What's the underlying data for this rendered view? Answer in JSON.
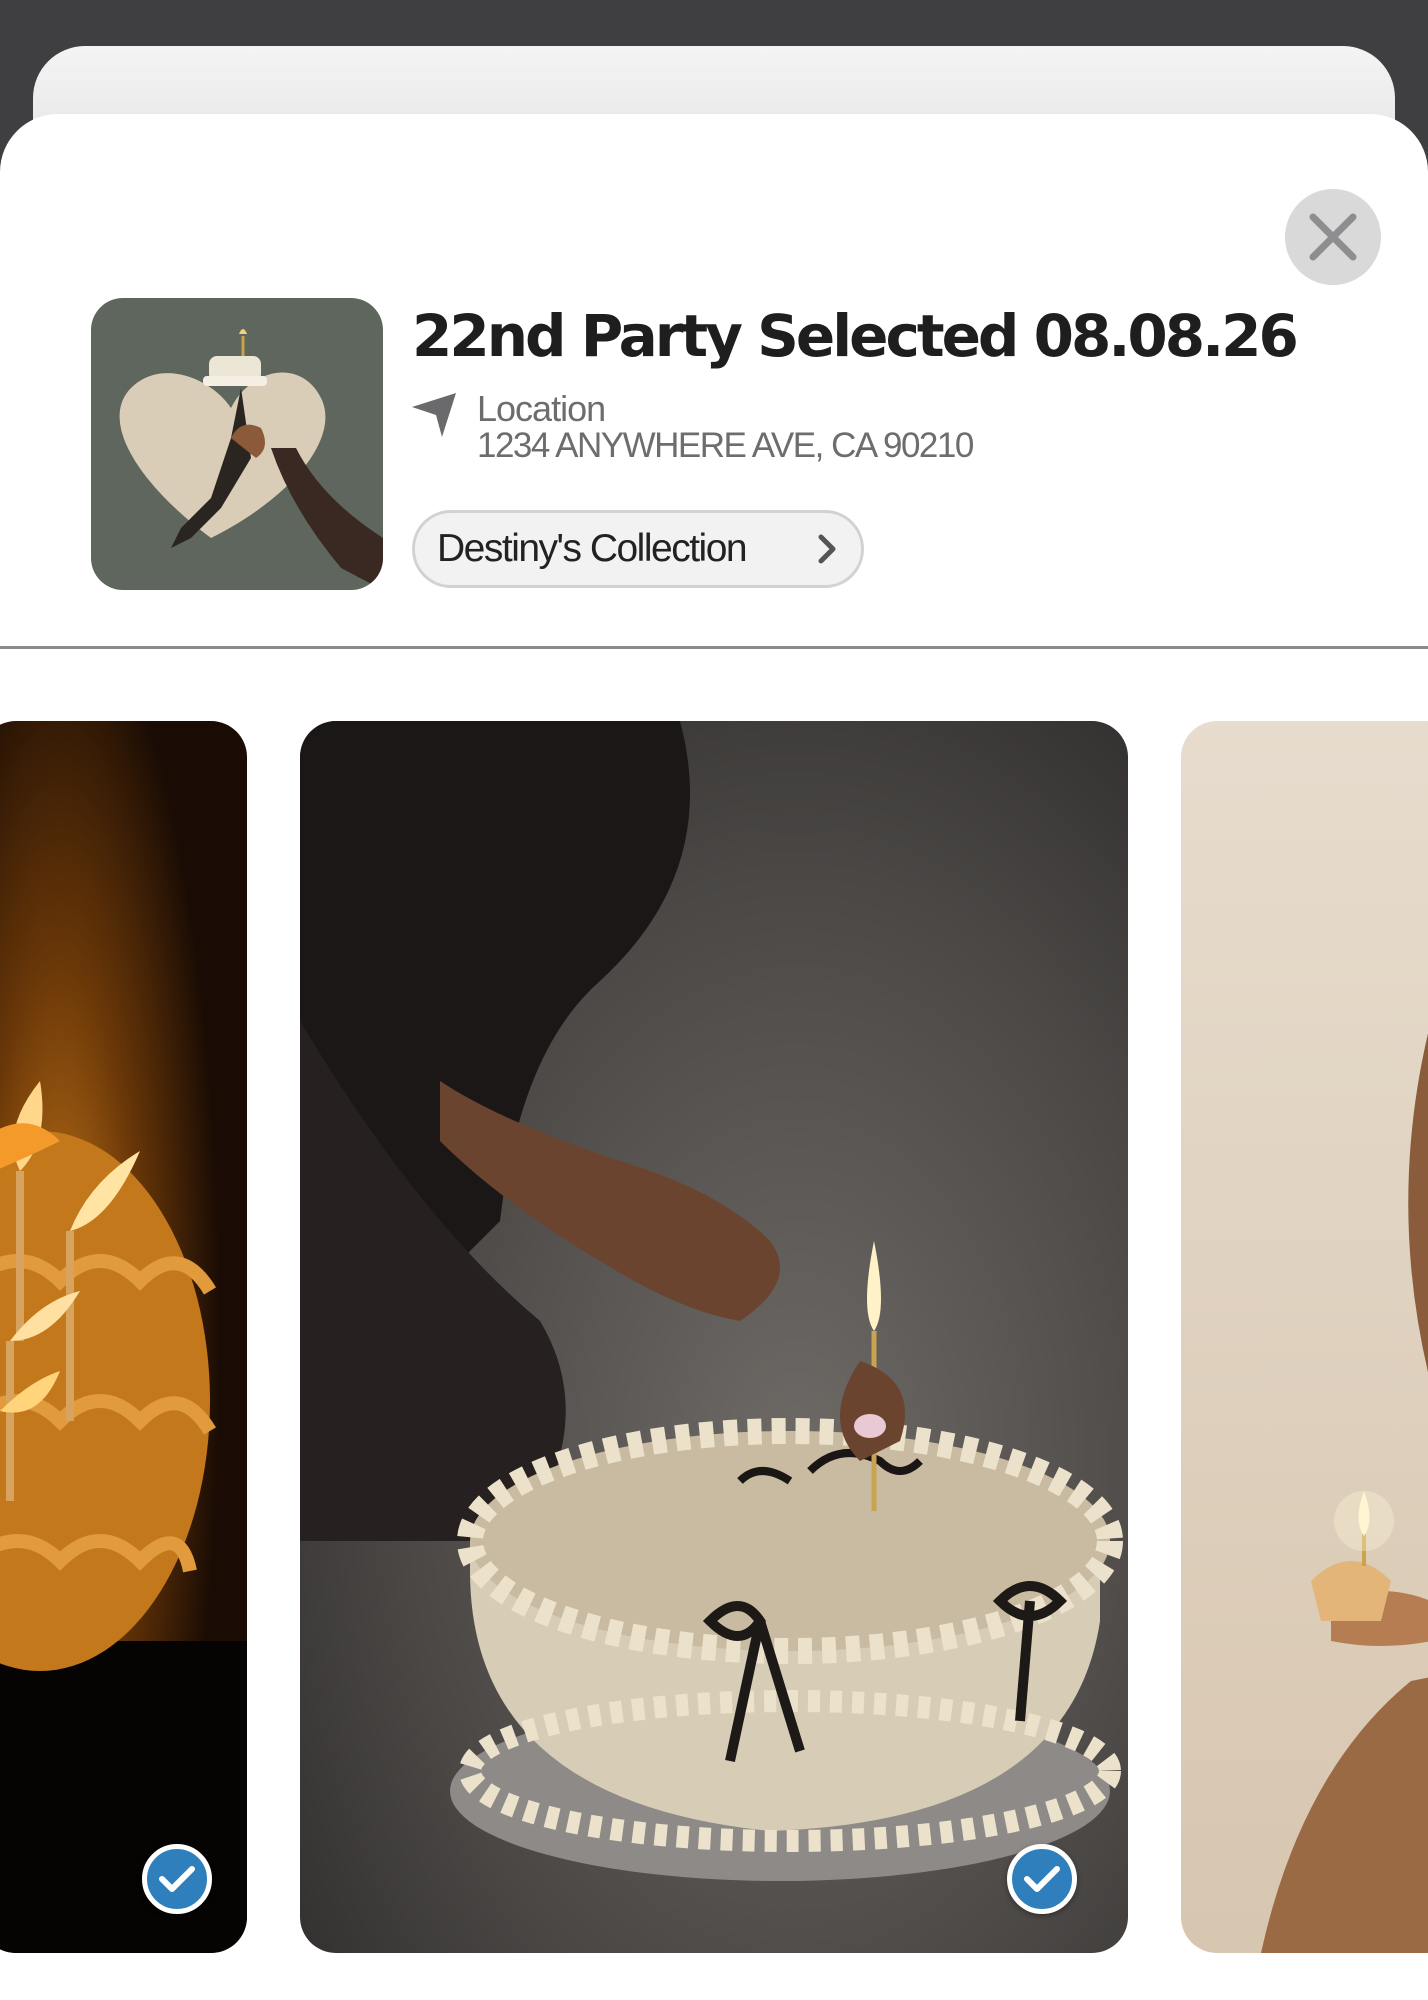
{
  "event": {
    "title": "22nd Party Selected  08.08.26",
    "location_label": "Location",
    "location_address": "1234 ANYWHERE AVE, CA 90210",
    "collection_label": "Destiny's Collection"
  },
  "icons": {
    "close": "close-icon",
    "location": "navigation-arrow-icon",
    "chevron": "chevron-right-icon",
    "check": "check-icon"
  },
  "photos": [
    {
      "description": "birthday cake with lit candles",
      "selected": true
    },
    {
      "description": "hand lighting candle on cream bow cake",
      "selected": true
    },
    {
      "description": "person holding cupcake with candle",
      "selected": false
    }
  ],
  "colors": {
    "check_blue": "#2f7fbd",
    "backdrop": "#3f3f41",
    "sheet": "#ffffff"
  }
}
